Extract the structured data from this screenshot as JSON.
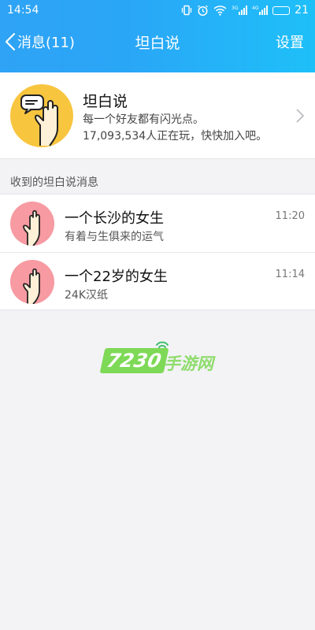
{
  "status_bar": {
    "time": "14:54",
    "network_label_1": "3G",
    "network_label_2": "4G",
    "battery": "21"
  },
  "nav": {
    "back_label": "消息(11)",
    "title": "坦白说",
    "settings_label": "设置"
  },
  "intro": {
    "title": "坦白说",
    "line1": "每一个好友都有闪光点。",
    "line2": "17,093,534人正在玩，快快加入吧。"
  },
  "section_label": "收到的坦白说消息",
  "messages": [
    {
      "title": "一个长沙的女生",
      "subtitle": "有着与生俱来的运气",
      "time": "11:20"
    },
    {
      "title": "一个22岁的女生",
      "subtitle": "24K汉纸",
      "time": "11:14"
    }
  ],
  "watermark": {
    "number": "7230",
    "text": "手游网"
  },
  "colors": {
    "accent": "#2aa6f7",
    "intro_avatar_bg": "#f8c53f",
    "message_avatar_bg": "#f79aa2",
    "watermark_green": "#7ed957"
  }
}
